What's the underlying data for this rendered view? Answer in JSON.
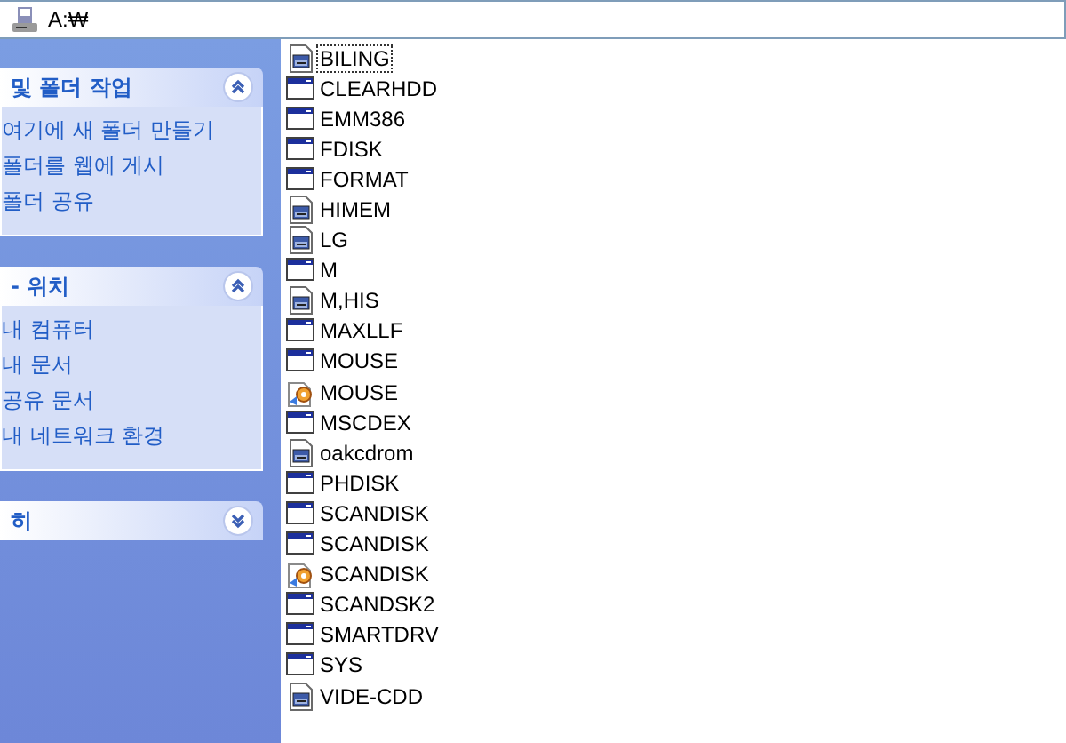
{
  "address_bar": {
    "path": "A:₩"
  },
  "task_panes": [
    {
      "title": "및 폴더 작업",
      "expanded": true,
      "links": [
        "여기에 새 폴더 만들기",
        "폴더를 웹에 게시",
        "폴더 공유"
      ]
    },
    {
      "title": "- 위치",
      "expanded": true,
      "links": [
        "내 컴퓨터",
        "내 문서",
        "공유 문서",
        "내 네트워크 환경"
      ]
    },
    {
      "title": "히",
      "expanded": false
    }
  ],
  "files": [
    {
      "name": "BILING",
      "kind": "batch",
      "focused": true
    },
    {
      "name": "CLEARHDD",
      "kind": "app",
      "focused": false
    },
    {
      "name": "EMM386",
      "kind": "app",
      "focused": false
    },
    {
      "name": "FDISK",
      "kind": "app",
      "focused": false
    },
    {
      "name": "FORMAT",
      "kind": "app",
      "focused": false
    },
    {
      "name": "HIMEM",
      "kind": "batch",
      "focused": false
    },
    {
      "name": "LG",
      "kind": "batch",
      "focused": false
    },
    {
      "name": "M",
      "kind": "app",
      "focused": false
    },
    {
      "name": "M,HIS",
      "kind": "batch",
      "focused": false
    },
    {
      "name": "MAXLLF",
      "kind": "app",
      "focused": false
    },
    {
      "name": "MOUSE",
      "kind": "app",
      "focused": false
    },
    {
      "name": "MOUSE",
      "kind": "shortcut",
      "focused": false
    },
    {
      "name": "MSCDEX",
      "kind": "app",
      "focused": false
    },
    {
      "name": "oakcdrom",
      "kind": "batch",
      "focused": false
    },
    {
      "name": "PHDISK",
      "kind": "app",
      "focused": false
    },
    {
      "name": "SCANDISK",
      "kind": "app",
      "focused": false
    },
    {
      "name": "SCANDISK",
      "kind": "app",
      "focused": false
    },
    {
      "name": "SCANDISK",
      "kind": "shortcut",
      "focused": false
    },
    {
      "name": "SCANDSK2",
      "kind": "app",
      "focused": false
    },
    {
      "name": "SMARTDRV",
      "kind": "app",
      "focused": false
    },
    {
      "name": "SYS",
      "kind": "app",
      "focused": false
    },
    {
      "name": "VIDE-CDD",
      "kind": "batch",
      "focused": false
    }
  ]
}
